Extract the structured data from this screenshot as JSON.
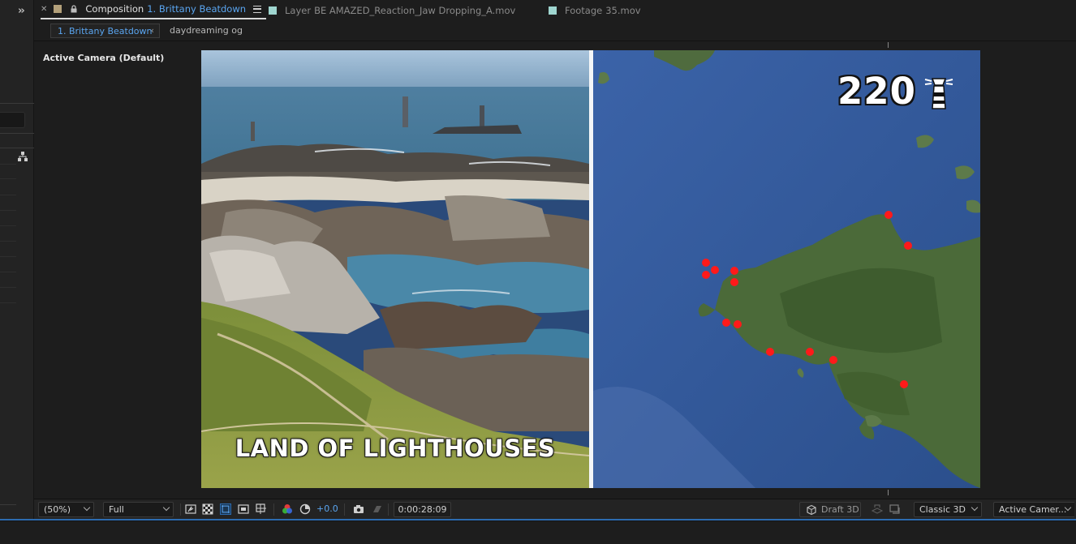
{
  "tabs": [
    {
      "kind": "Composition",
      "name": "1. Brittany Beatdown",
      "active": true,
      "swatch": "#b3a07a"
    },
    {
      "kind": "Layer",
      "name": "BE AMAZED_Reaction_Jaw Dropping_A.mov",
      "active": false,
      "swatch": "#9fd6d0"
    },
    {
      "kind": "Footage",
      "name": "35.mov",
      "active": false,
      "swatch": "#9fd6d0"
    }
  ],
  "breadcrumb": [
    "1. Brittany Beatdown",
    "daydreaming og"
  ],
  "viewer": {
    "camera_label": "Active Camera (Default)",
    "caption": "LAND OF LIGHTHOUSES",
    "counter": "220"
  },
  "footer": {
    "zoom": "(50%)",
    "resolution": "Full",
    "exposure": "+0.0",
    "timecode": "0:00:28:09",
    "draft3d": "Draft 3D",
    "renderer": "Classic 3D",
    "view": "Active Camer..."
  },
  "colors": {
    "accent": "#5aa5f0",
    "marker": "#ff1a1a",
    "sea": "#2f5a9c"
  }
}
